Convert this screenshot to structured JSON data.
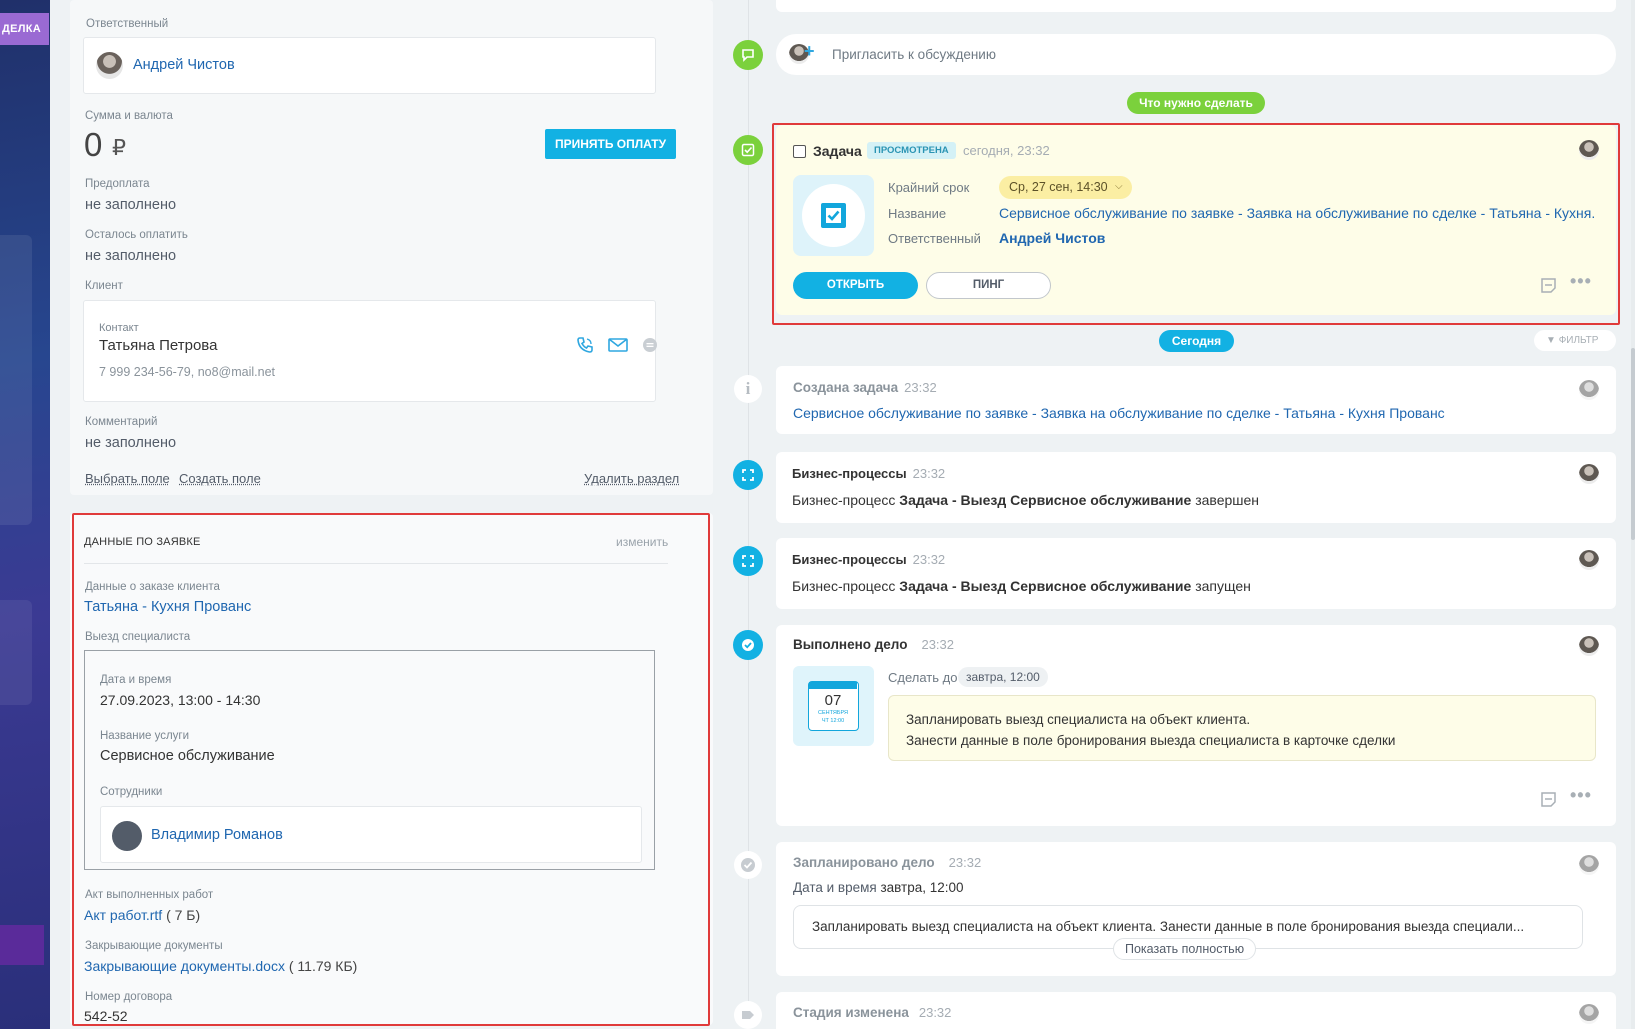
{
  "leftbar": {
    "tag": "ДЕЛКА"
  },
  "deal": {
    "responsible_label": "Ответственный",
    "responsible_name": "Андрей Чистов",
    "amount_label": "Сумма и валюта",
    "amount_value": "0",
    "currency": "₽",
    "accept_payment": "ПРИНЯТЬ ОПЛАТУ",
    "prepay_label": "Предоплата",
    "prepay_value": "не заполнено",
    "remaining_label": "Осталось оплатить",
    "remaining_value": "не заполнено",
    "client_label": "Клиент",
    "contact_label": "Контакт",
    "contact_name": "Татьяна Петрова",
    "contact_info": "7 999 234-56-79, no8@mail.net",
    "comment_label": "Комментарий",
    "comment_value": "не заполнено",
    "choose_field": "Выбрать поле",
    "create_field": "Создать поле",
    "delete_section": "Удалить раздел"
  },
  "request": {
    "title": "ДАННЫЕ ПО ЗАЯВКЕ",
    "edit": "изменить",
    "order_label": "Данные о заказе клиента",
    "order_value": "Татьяна - Кухня Прованс",
    "visit_label": "Выезд специалиста",
    "datetime_label": "Дата и время",
    "datetime_value": "27.09.2023, 13:00 - 14:30",
    "service_label": "Название услуги",
    "service_value": "Сервисное обслуживание",
    "staff_label": "Сотрудники",
    "staff_name": "Владимир Романов",
    "act_label": "Акт выполненных работ",
    "act_file": "Акт работ.rtf",
    "act_size": "( 7 Б)",
    "closing_label": "Закрывающие документы",
    "closing_file": "Закрывающие документы.docx",
    "closing_size": "( 11.79 КБ)",
    "contract_label": "Номер договора",
    "contract_value": "542-52"
  },
  "timeline": {
    "invite": "Пригласить к обсуждению",
    "todo_pill": "Что нужно сделать",
    "task": {
      "title": "Задача",
      "badge": "ПРОСМОТРЕНА",
      "time": "сегодня, 23:32",
      "deadline_label": "Крайний срок",
      "deadline_value": "Ср, 27 сен, 14:30",
      "name_label": "Название",
      "name_value": "Сервисное обслуживание по заявке - Заявка на обслуживание по сделке - Татьяна - Кухня...",
      "resp_label": "Ответственный",
      "resp_value": "Андрей Чистов",
      "open": "ОТКРЫТЬ",
      "ping": "ПИНГ"
    },
    "today_pill": "Сегодня",
    "filter": "ФИЛЬТР",
    "created": {
      "title": "Создана задача",
      "time": "23:32",
      "text": "Сервисное обслуживание по заявке - Заявка на обслуживание по сделке - Татьяна - Кухня Прованс"
    },
    "bp1": {
      "title": "Бизнес-процессы",
      "time": "23:32",
      "pre": "Бизнес-процесс ",
      "bold": "Задача - Выезд Сервисное обслуживание",
      "post": " завершен"
    },
    "bp2": {
      "title": "Бизнес-процессы",
      "time": "23:32",
      "pre": "Бизнес-процесс ",
      "bold": "Задача - Выезд Сервисное обслуживание",
      "post": " запущен"
    },
    "done": {
      "title": "Выполнено дело",
      "time": "23:32",
      "due_label": "Сделать до",
      "due_value": "завтра, 12:00",
      "cal_day": "07",
      "cal_month": "СЕНТЯБРЯ",
      "cal_time": "ЧТ 12:00",
      "line1": "Запланировать выезд специалиста на объект клиента.",
      "line2": "Занести данные в поле бронирования выезда специалиста в карточке сделки"
    },
    "planned": {
      "title": "Запланировано дело",
      "time": "23:32",
      "dt_label": "Дата и время ",
      "dt_value": "завтра, 12:00",
      "text": "Запланировать выезд специалиста на объект клиента. Занести данные в поле бронирования выезда специали...",
      "show_full": "Показать полностью"
    },
    "stage": {
      "title": "Стадия изменена",
      "time": "23:32"
    }
  }
}
